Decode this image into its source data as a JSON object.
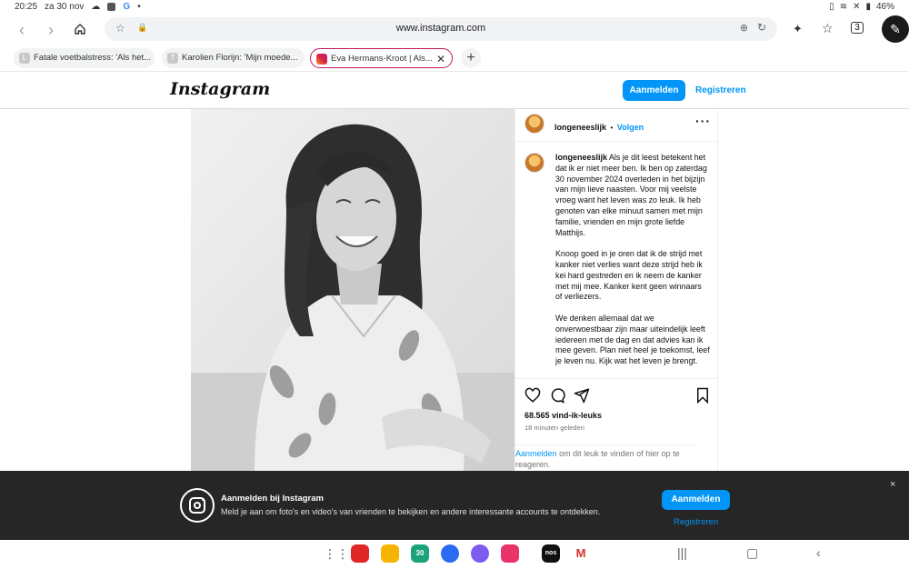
{
  "status_bar": {
    "time": "20:25",
    "date": "za 30 nov",
    "battery": "46%"
  },
  "browser": {
    "url": "www.instagram.com",
    "tabs": [
      {
        "label": "Fatale voetbalstress: 'Als het...",
        "favicon_letter": "L"
      },
      {
        "label": "Karolien Florijn: 'Mijn moede...",
        "favicon_letter": "T"
      },
      {
        "label": "Eva Hermans-Kroot | Als...",
        "favicon_letter": "",
        "active": true
      }
    ]
  },
  "instagram": {
    "logo": "Instagram",
    "login_button": "Aanmelden",
    "register_link": "Registreren"
  },
  "post": {
    "username": "longeneeslijk",
    "separator": "•",
    "follow_label": "Volgen",
    "more_icon": "more-horizontal-icon",
    "caption_username": "longeneeslijk",
    "caption_p1": "Als je dit leest betekent het dat ik er niet meer ben. Ik ben op zaterdag 30 november 2024 overleden in het bijzijn van mijn lieve naasten. Voor mij veelste vroeg want het leven was zo leuk. Ik heb genoten van elke minuut samen met mijn familie, vrienden en mijn grote liefde Matthijs.",
    "caption_p2": "Knoop goed in je oren dat ik de strijd met kanker niet verlies want deze strijd heb ik kei hard gestreden en ik neem de kanker met mij mee. Kanker kent geen winnaars of verliezers.",
    "caption_p3": "We denken allemaal dat we onverwoestbaar zijn maar uiteindelijk leeft iedereen met de dag en dat advies kan ik mee geven. Plan niet heel je toekomst, leef je leven nu. Kijk wat het leven je brengt.",
    "likes": "68.565 vind-ik-leuks",
    "time": "18 minuten geleden",
    "signin_link": "Aanmelden",
    "signin_rest": "om dit leuk te vinden of hier op te reageren."
  },
  "banner": {
    "title": "Aanmelden bij Instagram",
    "text": "Meld je aan om foto's en video's van vrienden te bekijken en andere interessante accounts te ontdekken.",
    "login_button": "Aanmelden",
    "register_link": "Registreren",
    "close": "×"
  },
  "dock": {
    "apps": [
      {
        "name": "apps-grid-icon",
        "color": "#ffffff"
      },
      {
        "name": "flipboard-icon",
        "color": "#e12828"
      },
      {
        "name": "files-icon",
        "color": "#f5b400"
      },
      {
        "name": "calendar-icon",
        "color": "#1aa37a",
        "label": "30"
      },
      {
        "name": "messages-icon",
        "color": "#2a6bf2"
      },
      {
        "name": "internet-icon",
        "color": "#7b5cf0"
      },
      {
        "name": "gallery-icon",
        "color": "#e8336b"
      },
      {
        "name": "nos-icon",
        "color": "#111111",
        "label": "nos"
      },
      {
        "name": "gmail-icon",
        "color": "#ffffff"
      }
    ]
  }
}
